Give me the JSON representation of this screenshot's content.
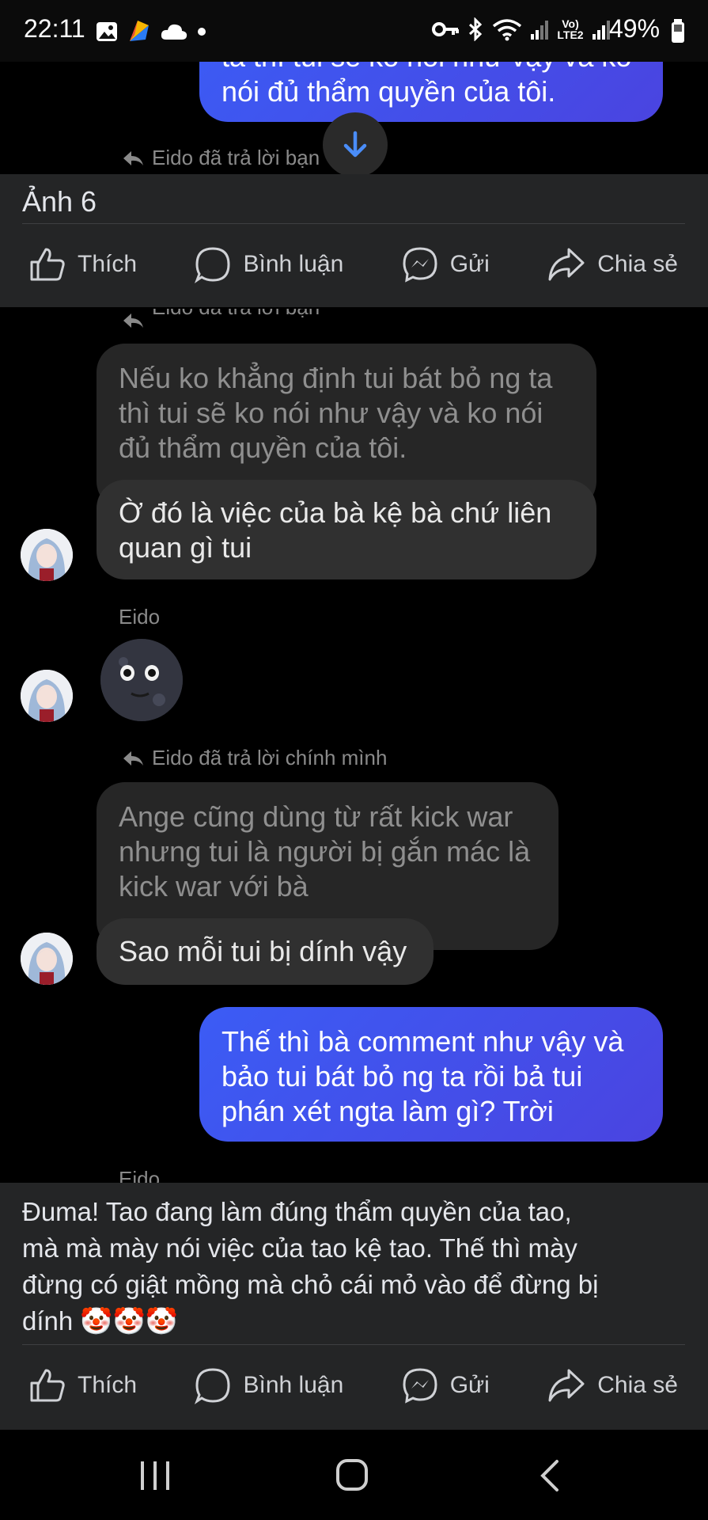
{
  "status_bar": {
    "time": "22:11",
    "network": "Vo) LTE2",
    "battery": "49%"
  },
  "top_partial_message": {
    "line1": "ta thì tui sẽ ko nói như vậy và ko",
    "line2": "nói đủ thẩm quyền của tôi."
  },
  "top_reply_hint": "Eido đã trả lời bạn",
  "photo_title": "Ảnh 6",
  "actions": {
    "like": "Thích",
    "comment": "Bình luận",
    "send": "Gửi",
    "share": "Chia sẻ"
  },
  "chat": {
    "reply_hint_1": "Eido đã trả lời bạn",
    "quoted_1": [
      "Nếu ko khẳng định tui bát bỏ ng ta",
      "thì tui sẽ ko nói như vậy và ko nói",
      "đủ thẩm quyền của tôi."
    ],
    "message_1": [
      "Ờ đó là việc của bà kệ bà chứ liên",
      "quan gì tui"
    ],
    "sender_name": "Eido",
    "reply_hint_2": "Eido đã trả lời chính mình",
    "quoted_2": [
      "Ange cũng dùng từ rất kick war",
      "nhưng tui là người bị gắn mác là",
      "kick war với bà"
    ],
    "message_2": "Sao mỗi tui bị dính vậy",
    "outgoing": [
      "Thế thì bà comment như vậy và",
      "bảo tui bát bỏ ng ta rồi bả tui",
      "phán xét ngta làm gì? Trời"
    ],
    "partial_sender": "Eido"
  },
  "caption": {
    "lines": [
      "Đuma! Tao đang làm đúng thẩm quyền của tao,",
      "mà mà mày nói việc của tao kệ tao. Thế thì mày",
      "đừng có giật mồng mà chỏ cái mỏ vào để đừng bị",
      "dính"
    ],
    "emoji": "🤡🤡🤡"
  },
  "colors": {
    "outgoing_bubble": "#3b5cf5",
    "incoming_bubble": "#2b2b2b",
    "panel": "#242526",
    "scroll_button_arrow": "#4a8df8"
  }
}
